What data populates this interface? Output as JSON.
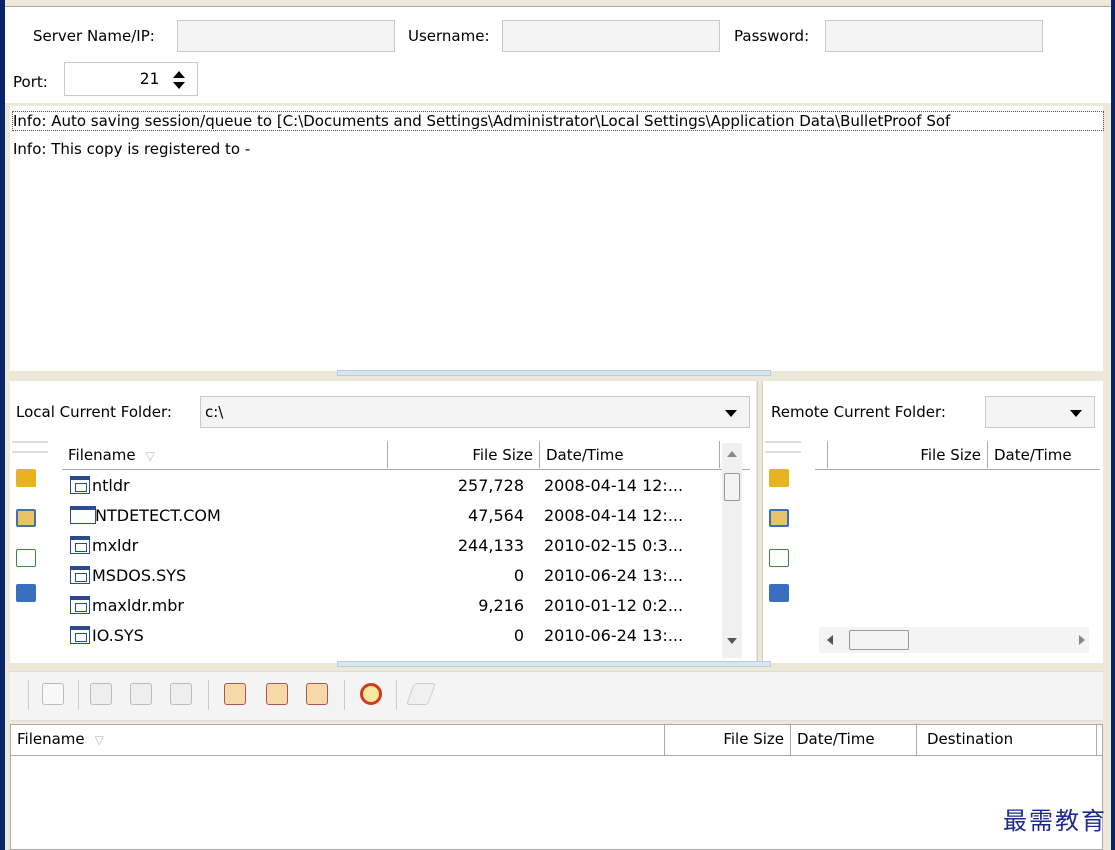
{
  "connection": {
    "server_label": "Server Name/IP:",
    "server_value": "",
    "username_label": "Username:",
    "username_value": "",
    "password_label": "Password:",
    "password_value": "",
    "port_label": "Port:",
    "port_value": "21"
  },
  "log": [
    "Info: Auto saving session/queue to [C:\\Documents and Settings\\Administrator\\Local Settings\\Application Data\\BulletProof Sof",
    "Info: This copy is registered to  -"
  ],
  "local": {
    "folder_label": "Local Current Folder:",
    "folder_value": "c:\\",
    "columns": [
      "Filename",
      "File Size",
      "Date/Time"
    ],
    "files": [
      {
        "name": "ntldr",
        "size": "257,728",
        "date": "2008-04-14 12:...",
        "icon": "system-file-icon"
      },
      {
        "name": "NTDETECT.COM",
        "size": "47,564",
        "date": "2008-04-14 12:...",
        "icon": "application-window-icon"
      },
      {
        "name": "mxldr",
        "size": "244,133",
        "date": "2010-02-15 0:3...",
        "icon": "system-file-icon"
      },
      {
        "name": "MSDOS.SYS",
        "size": "0",
        "date": "2010-06-24 13:...",
        "icon": "system-file-icon"
      },
      {
        "name": "maxldr.mbr",
        "size": "9,216",
        "date": "2010-01-12 0:2...",
        "icon": "system-file-icon"
      },
      {
        "name": "IO.SYS",
        "size": "0",
        "date": "2010-06-24 13:...",
        "icon": "system-file-icon"
      }
    ]
  },
  "remote": {
    "folder_label": "Remote Current Folder:",
    "folder_value": "",
    "columns": [
      "File Size",
      "Date/Time"
    ]
  },
  "queue": {
    "columns": [
      "Filename",
      "File Size",
      "Date/Time",
      "Destination"
    ]
  },
  "watermark": "最需教育",
  "colors": {
    "frame": "#0a246a",
    "folder_up": "#e8b321",
    "refresh": "#3a8a3a",
    "alarm": "#d43a1a"
  }
}
